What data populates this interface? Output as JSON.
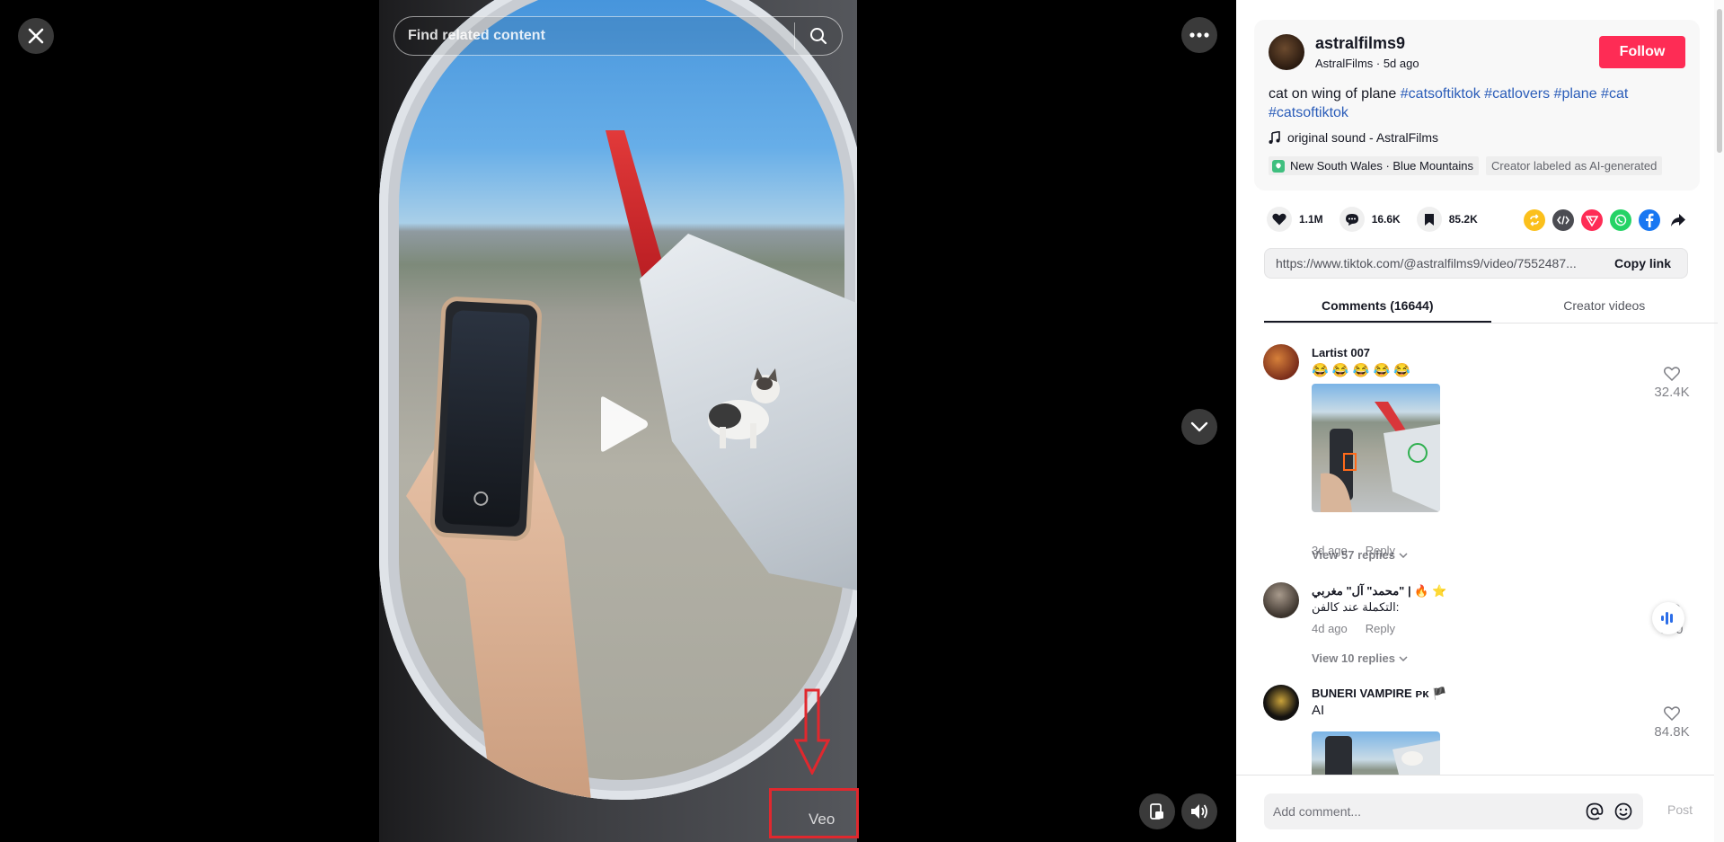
{
  "player": {
    "search_placeholder": "Find related content",
    "watermark": "Veo"
  },
  "video": {
    "author_handle": "astralfilms9",
    "author_sub": "AstralFilms · 5d ago",
    "follow_label": "Follow",
    "caption_text": "cat on wing of plane",
    "hashtags": [
      "#catsoftiktok",
      "#catlovers",
      "#plane",
      "#cat",
      "#catsoftiktok"
    ],
    "sound": "original sound - AstralFilms",
    "location": "New South Wales · Blue Mountains",
    "ai_label": "Creator labeled as AI-generated"
  },
  "stats": {
    "likes": "1.1M",
    "comments": "16.6K",
    "saves": "85.2K"
  },
  "share_icons": [
    "repost-icon",
    "embed-icon",
    "send-icon",
    "whatsapp-icon",
    "facebook-icon",
    "share-arrow-icon"
  ],
  "link": {
    "url": "https://www.tiktok.com/@astralfilms9/video/7552487...",
    "copy_label": "Copy link"
  },
  "tabs": [
    {
      "label": "Comments (16644)",
      "active": true
    },
    {
      "label": "Creator videos",
      "active": false
    }
  ],
  "comments": [
    {
      "name": "Lartist 007",
      "text": "😂 😂 😂 😂 😂",
      "age": "3d ago",
      "reply_label": "Reply",
      "replies": "View 57 replies",
      "likes": "32.4K"
    },
    {
      "name": "محمد\" آل\" مغربي\" | 🔥 ⭐",
      "text": "التكملة عند كالفن:",
      "age": "4d ago",
      "reply_label": "Reply",
      "replies": "View 10 replies",
      "likes": "160"
    },
    {
      "name": "BUNERI VAMPIRE ᴘᴋ 🏴",
      "text": "AI",
      "likes": "84.8K"
    }
  ],
  "composer": {
    "placeholder": "Add comment...",
    "post_label": "Post"
  },
  "colors": {
    "accent": "#fe2c55",
    "hashtag": "#2b5db9",
    "annotation_red": "#e0282e"
  }
}
